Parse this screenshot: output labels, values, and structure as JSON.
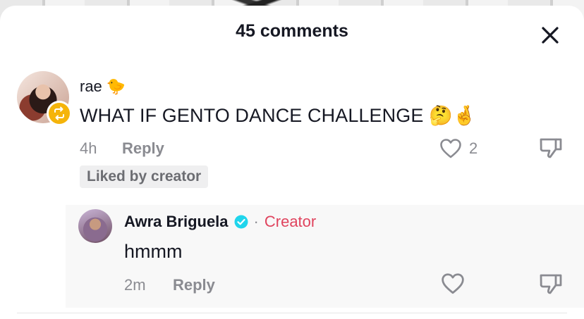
{
  "header": {
    "title": "45 comments"
  },
  "comment": {
    "username": "rae",
    "username_emoji": "🐤",
    "text": "WHAT IF GENTO DANCE CHALLENGE",
    "text_emojis": "🤔🤞",
    "time": "4h",
    "reply_label": "Reply",
    "like_count": "2",
    "liked_by_creator": "Liked by creator"
  },
  "reply": {
    "username": "Awra Briguela",
    "separator": "·",
    "creator_label": "Creator",
    "text": "hmmm",
    "time": "2m",
    "reply_label": "Reply"
  },
  "colors": {
    "creator": "#e0445e",
    "verified": "#20d5ec",
    "repost_badge": "#f5b40a",
    "muted": "#8a8b91"
  }
}
